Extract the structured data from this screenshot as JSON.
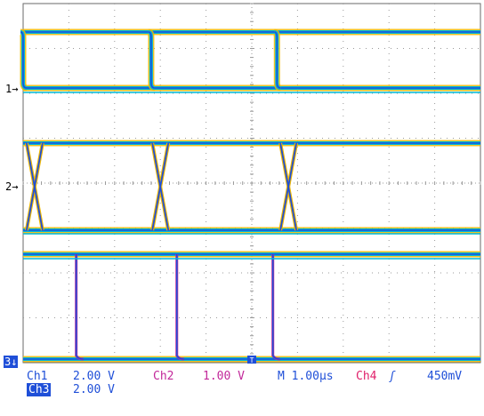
{
  "colors": {
    "ch1": "#1f4fd8",
    "ch2": "#c2289a",
    "ch3": "#1f4fd8",
    "ch4": "#e0206a",
    "trace_glow": "#00b8d8",
    "noise": "#f0b800",
    "grid": "#9a9a9a",
    "frame": "#6a6a6a"
  },
  "markers": {
    "ch1": "1→",
    "ch2": "2→",
    "ch3": "3↓"
  },
  "status": {
    "ch1_label": "Ch1",
    "ch1_scale": "2.00 V",
    "ch2_label": "Ch2",
    "ch2_scale": "1.00 V",
    "timebase": "M 1.00µs",
    "trigger_source": "Ch4",
    "trigger_slope_icon": "rising-edge-icon",
    "trigger_glyph": "ʃ",
    "trigger_level": "450mV",
    "ch3_label": "Ch3",
    "ch3_scale": "2.00 V"
  },
  "waveforms": {
    "ch1_edges_us": [
      0.0,
      2.8,
      5.55
    ],
    "ch2_crossings_us": [
      0.25,
      3.0,
      5.8
    ],
    "ch3_edges_us": [
      1.2,
      3.4,
      5.5
    ],
    "time_per_div_us": 1.0
  }
}
